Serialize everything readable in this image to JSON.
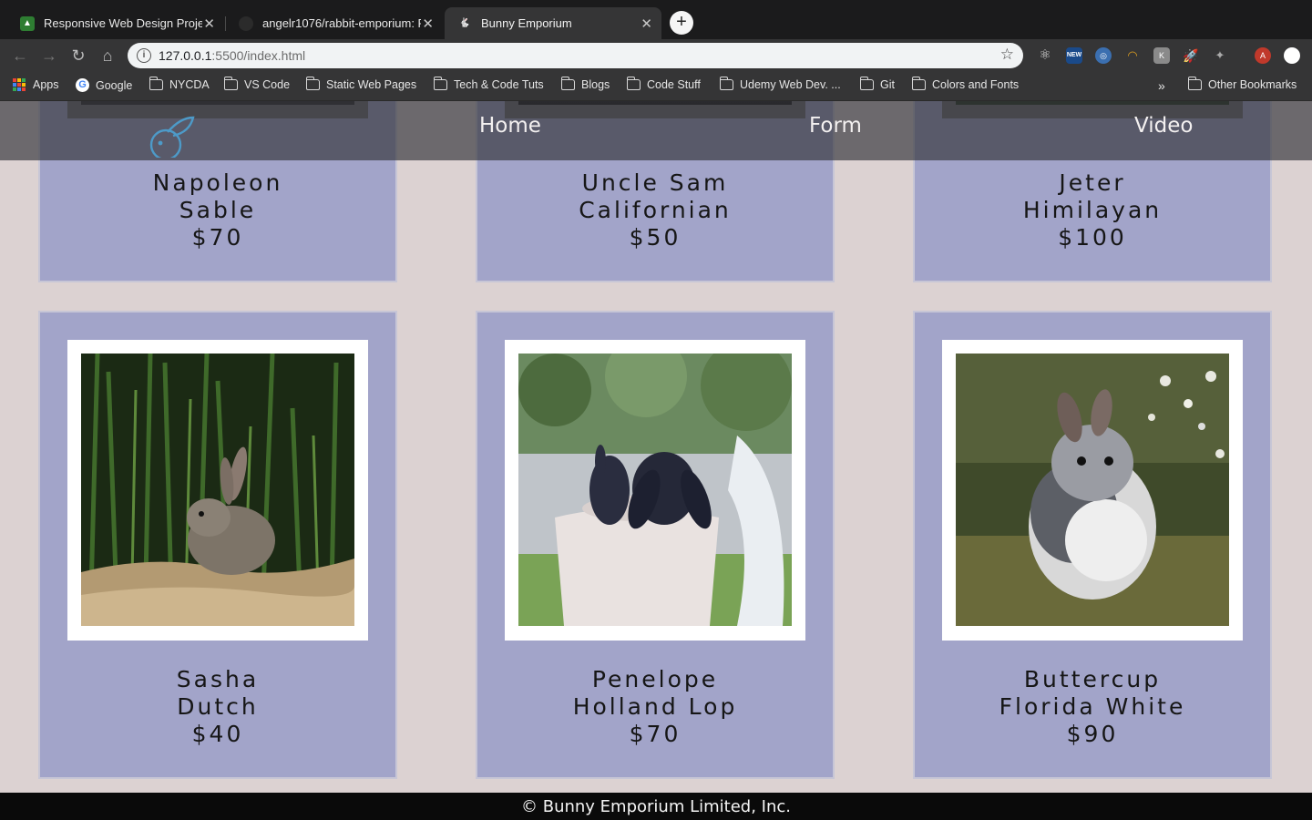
{
  "browser": {
    "tabs": [
      {
        "title": "Responsive Web Design Projec",
        "favicon": "fcc-icon"
      },
      {
        "title": "angelr1076/rabbit-emporium: P",
        "favicon": "github-icon"
      },
      {
        "title": "Bunny Emporium",
        "favicon": "bunny-icon"
      }
    ],
    "url_host": "127.0.0.1",
    "url_path": ":5500/index.html",
    "bookmarks": [
      "Apps",
      "Google",
      "NYCDA",
      "VS Code",
      "Static Web Pages",
      "Tech & Code Tuts",
      "Blogs",
      "Code Stuff",
      "Udemy Web Dev. ...",
      "Git",
      "Colors and Fonts"
    ],
    "other_bookmarks": "Other Bookmarks",
    "profile_initial": "A"
  },
  "site": {
    "nav": {
      "home": "Home",
      "form": "Form",
      "video": "Video"
    },
    "footer": "© Bunny Emporium Limited, Inc.",
    "colors": {
      "card_bg": "#a2a4c9",
      "page_bg": "#dcd2d2",
      "nav_bg": "#37373c",
      "logo": "#4d9ac8"
    }
  },
  "rabbits": [
    {
      "name": "Napoleon",
      "breed": "Sable",
      "price": "$70"
    },
    {
      "name": "Uncle Sam",
      "breed": "Californian",
      "price": "$50"
    },
    {
      "name": "Jeter",
      "breed": "Himilayan",
      "price": "$100"
    },
    {
      "name": "Sasha",
      "breed": "Dutch",
      "price": "$40"
    },
    {
      "name": "Penelope",
      "breed": "Holland Lop",
      "price": "$70"
    },
    {
      "name": "Buttercup",
      "breed": "Florida White",
      "price": "$90"
    }
  ]
}
